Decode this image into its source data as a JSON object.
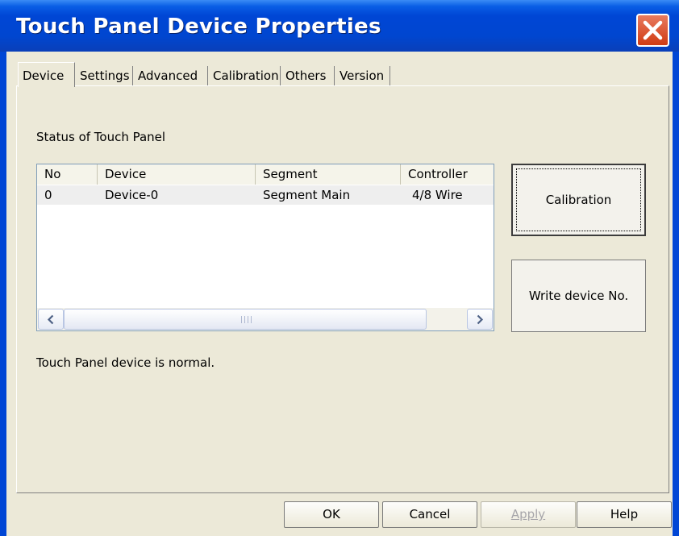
{
  "window": {
    "title": "Touch Panel Device Properties"
  },
  "tabs": [
    {
      "label": "Device",
      "active": true
    },
    {
      "label": "Settings",
      "active": false
    },
    {
      "label": "Advanced",
      "active": false
    },
    {
      "label": "Calibration",
      "active": false
    },
    {
      "label": "Others",
      "active": false
    },
    {
      "label": "Version",
      "active": false
    }
  ],
  "device_tab": {
    "status_label": "Status of Touch Panel",
    "columns": [
      "No",
      "Device",
      "Segment",
      "Controller"
    ],
    "rows": [
      {
        "no": "0",
        "device": "Device-0",
        "segment": "Segment Main",
        "controller": "4/8 Wire"
      }
    ],
    "status_message": "Touch Panel device is normal.",
    "calibration_button": "Calibration",
    "write_device_button": "Write device No."
  },
  "buttons": {
    "ok": "OK",
    "cancel": "Cancel",
    "apply": "Apply",
    "help": "Help"
  },
  "icons": {
    "close": "close-icon",
    "scroll_left": "chevron-left-icon",
    "scroll_right": "chevron-right-icon",
    "scroll_grip": "grip-icon"
  },
  "colors": {
    "titlebar": "#0046d5",
    "close_button": "#d13b13",
    "dialog_face": "#ece9d8",
    "list_border": "#7f9db9"
  }
}
